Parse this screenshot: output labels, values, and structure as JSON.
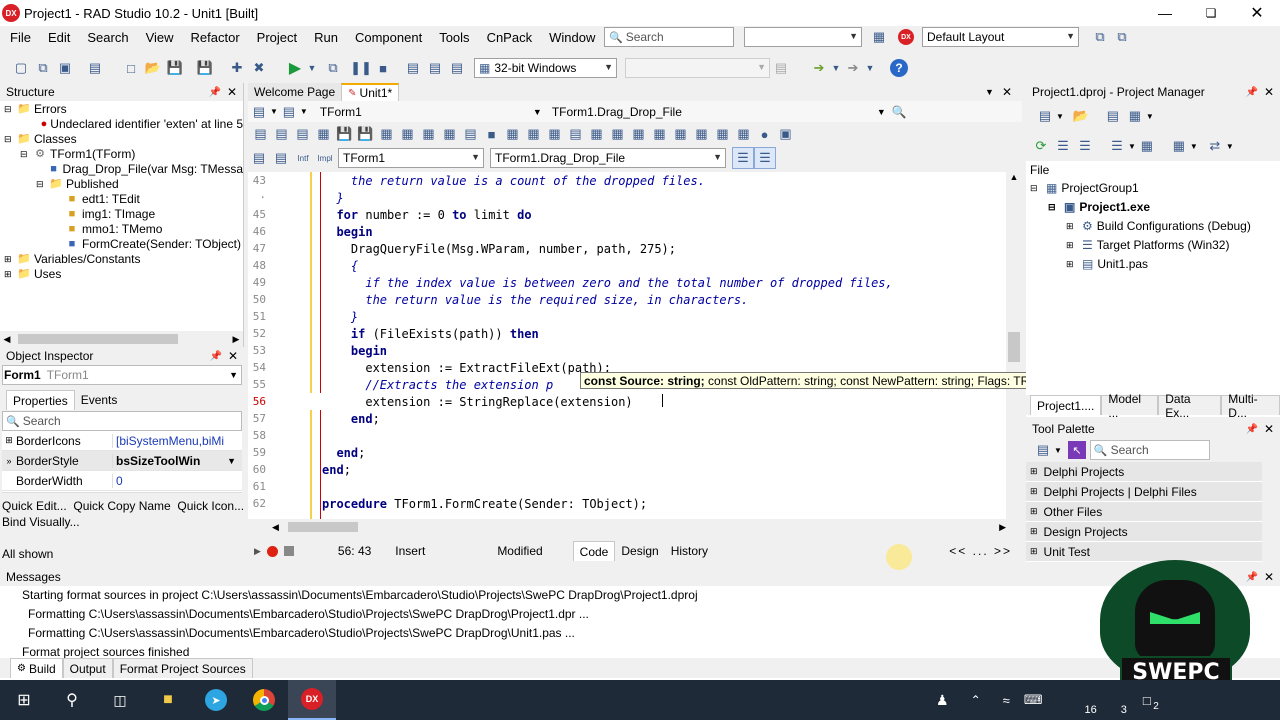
{
  "window": {
    "title": "Project1 - RAD Studio 10.2 - Unit1 [Built]",
    "app_badge": "DX"
  },
  "menu": [
    "File",
    "Edit",
    "Search",
    "View",
    "Refactor",
    "Project",
    "Run",
    "Component",
    "Tools",
    "CnPack",
    "Window",
    "Help"
  ],
  "toolbar": {
    "search_placeholder": "Search",
    "layout": "Default Layout",
    "platform": "32-bit Windows"
  },
  "structure": {
    "title": "Structure",
    "items": [
      {
        "label": "Errors",
        "indent": 0,
        "icon": "error-folder"
      },
      {
        "label": "Undeclared identifier 'exten' at line 5",
        "indent": 2,
        "icon": "error-dot"
      },
      {
        "label": "Classes",
        "indent": 0,
        "icon": "folder"
      },
      {
        "label": "TForm1(TForm)",
        "indent": 1,
        "icon": "class"
      },
      {
        "label": "Drag_Drop_File(var Msg: TMessa",
        "indent": 2,
        "icon": "method"
      },
      {
        "label": "Published",
        "indent": 2,
        "icon": "folder"
      },
      {
        "label": "edt1: TEdit",
        "indent": 3,
        "icon": "field"
      },
      {
        "label": "img1: TImage",
        "indent": 3,
        "icon": "field"
      },
      {
        "label": "mmo1: TMemo",
        "indent": 3,
        "icon": "field"
      },
      {
        "label": "FormCreate(Sender: TObject)",
        "indent": 3,
        "icon": "method"
      },
      {
        "label": "Variables/Constants",
        "indent": 0,
        "icon": "folder"
      },
      {
        "label": "Uses",
        "indent": 0,
        "icon": "folder"
      }
    ]
  },
  "object_inspector": {
    "title": "Object Inspector",
    "selected": "Form1",
    "type": "TForm1",
    "tabs": [
      "Properties",
      "Events"
    ],
    "search": "Search",
    "props": [
      {
        "name": "BorderIcons",
        "value": "[biSystemMenu,biMi"
      },
      {
        "name": "BorderStyle",
        "value": "bsSizeToolWin"
      },
      {
        "name": "BorderWidth",
        "value": "0"
      }
    ],
    "links": "Quick Edit...  Quick Copy Name  Quick Icon...",
    "bind": "Bind Visually...",
    "all_shown": "All shown"
  },
  "editor": {
    "tabs": [
      "Welcome Page",
      "Unit1*"
    ],
    "class_combo": "TForm1",
    "method_combo": "TForm1.Drag_Drop_File",
    "class_combo2": "TForm1",
    "method_combo2": "TForm1.Drag_Drop_File",
    "lines": [
      {
        "n": "43",
        "html": "    <span class='cm'>the return value is a count of the dropped files.</span>"
      },
      {
        "n": "·",
        "html": "  <span class='cm'>}</span>"
      },
      {
        "n": "45",
        "html": "  <span class='kw'>for</span> number := 0 <span class='kw'>to</span> limit <span class='kw'>do</span>"
      },
      {
        "n": "46",
        "html": "  <span class='kw'>begin</span>"
      },
      {
        "n": "47",
        "html": "    DragQueryFile(Msg.WParam, number, path, 275);"
      },
      {
        "n": "48",
        "html": "    <span class='cm'>{</span>"
      },
      {
        "n": "49",
        "html": "      <span class='cm'>if the index value is between zero and the total number of dropped files,</span>"
      },
      {
        "n": "50",
        "html": "      <span class='cm'>the return value is the required size, in characters.</span>"
      },
      {
        "n": "51",
        "html": "    <span class='cm'>}</span>"
      },
      {
        "n": "52",
        "html": "    <span class='kw'>if</span> (FileExists(path)) <span class='kw'>then</span>"
      },
      {
        "n": "53",
        "html": "    <span class='kw'>begin</span>"
      },
      {
        "n": "54",
        "html": "      extension := ExtractFileExt(path);"
      },
      {
        "n": "55",
        "html": "      <span class='cm'>//Extracts the extension p</span>"
      },
      {
        "n": "56",
        "html": "      extension := StringReplace(extension)"
      },
      {
        "n": "57",
        "html": "    <span class='kw'>end</span>;"
      },
      {
        "n": "58",
        "html": ""
      },
      {
        "n": "59",
        "html": "  <span class='kw'>end</span>;"
      },
      {
        "n": "60",
        "html": "<span class='kw'>end</span>;"
      },
      {
        "n": "61",
        "html": ""
      },
      {
        "n": "62",
        "html": "<span class='kw'>procedure</span> TForm1.FormCreate(Sender: TObject);"
      }
    ],
    "tooltip": {
      "bold": "const Source: string;",
      "rest": " const OldPattern: string; const NewPattern: string; Flags: TReplaceFlags"
    },
    "status": {
      "pos": "56: 43",
      "mode": "Insert",
      "modified": "Modified",
      "tabs": [
        "Code",
        "Design",
        "History"
      ]
    }
  },
  "project_manager": {
    "title": "Project1.dproj - Project Manager",
    "file": "File",
    "items": [
      {
        "label": "ProjectGroup1",
        "indent": 0,
        "bold": false
      },
      {
        "label": "Project1.exe",
        "indent": 1,
        "bold": true
      },
      {
        "label": "Build Configurations (Debug)",
        "indent": 2,
        "bold": false
      },
      {
        "label": "Target Platforms (Win32)",
        "indent": 2,
        "bold": false
      },
      {
        "label": "Unit1.pas",
        "indent": 2,
        "bold": false
      }
    ],
    "tabs": [
      "Project1....",
      "Model ...",
      "Data Ex...",
      "Multi-D..."
    ]
  },
  "tool_palette": {
    "title": "Tool Palette",
    "search": "Search",
    "items": [
      "Delphi Projects",
      "Delphi Projects | Delphi Files",
      "Other Files",
      "Design Projects",
      "Unit Test"
    ]
  },
  "messages": {
    "title": "Messages",
    "lines": [
      "Starting format sources in project C:\\Users\\assassin\\Documents\\Embarcadero\\Studio\\Projects\\SwePC DrapDrog\\Project1.dproj",
      "Formatting C:\\Users\\assassin\\Documents\\Embarcadero\\Studio\\Projects\\SwePC DrapDrog\\Project1.dpr ...",
      "Formatting C:\\Users\\assassin\\Documents\\Embarcadero\\Studio\\Projects\\SwePC DrapDrog\\Unit1.pas ...",
      "Format project sources finished"
    ],
    "tabs": [
      "Build",
      "Output",
      "Format Project Sources"
    ]
  },
  "taskbar": {
    "time": "16",
    "date": "3",
    "badge": "2",
    "logo_text": "SWEPC"
  }
}
